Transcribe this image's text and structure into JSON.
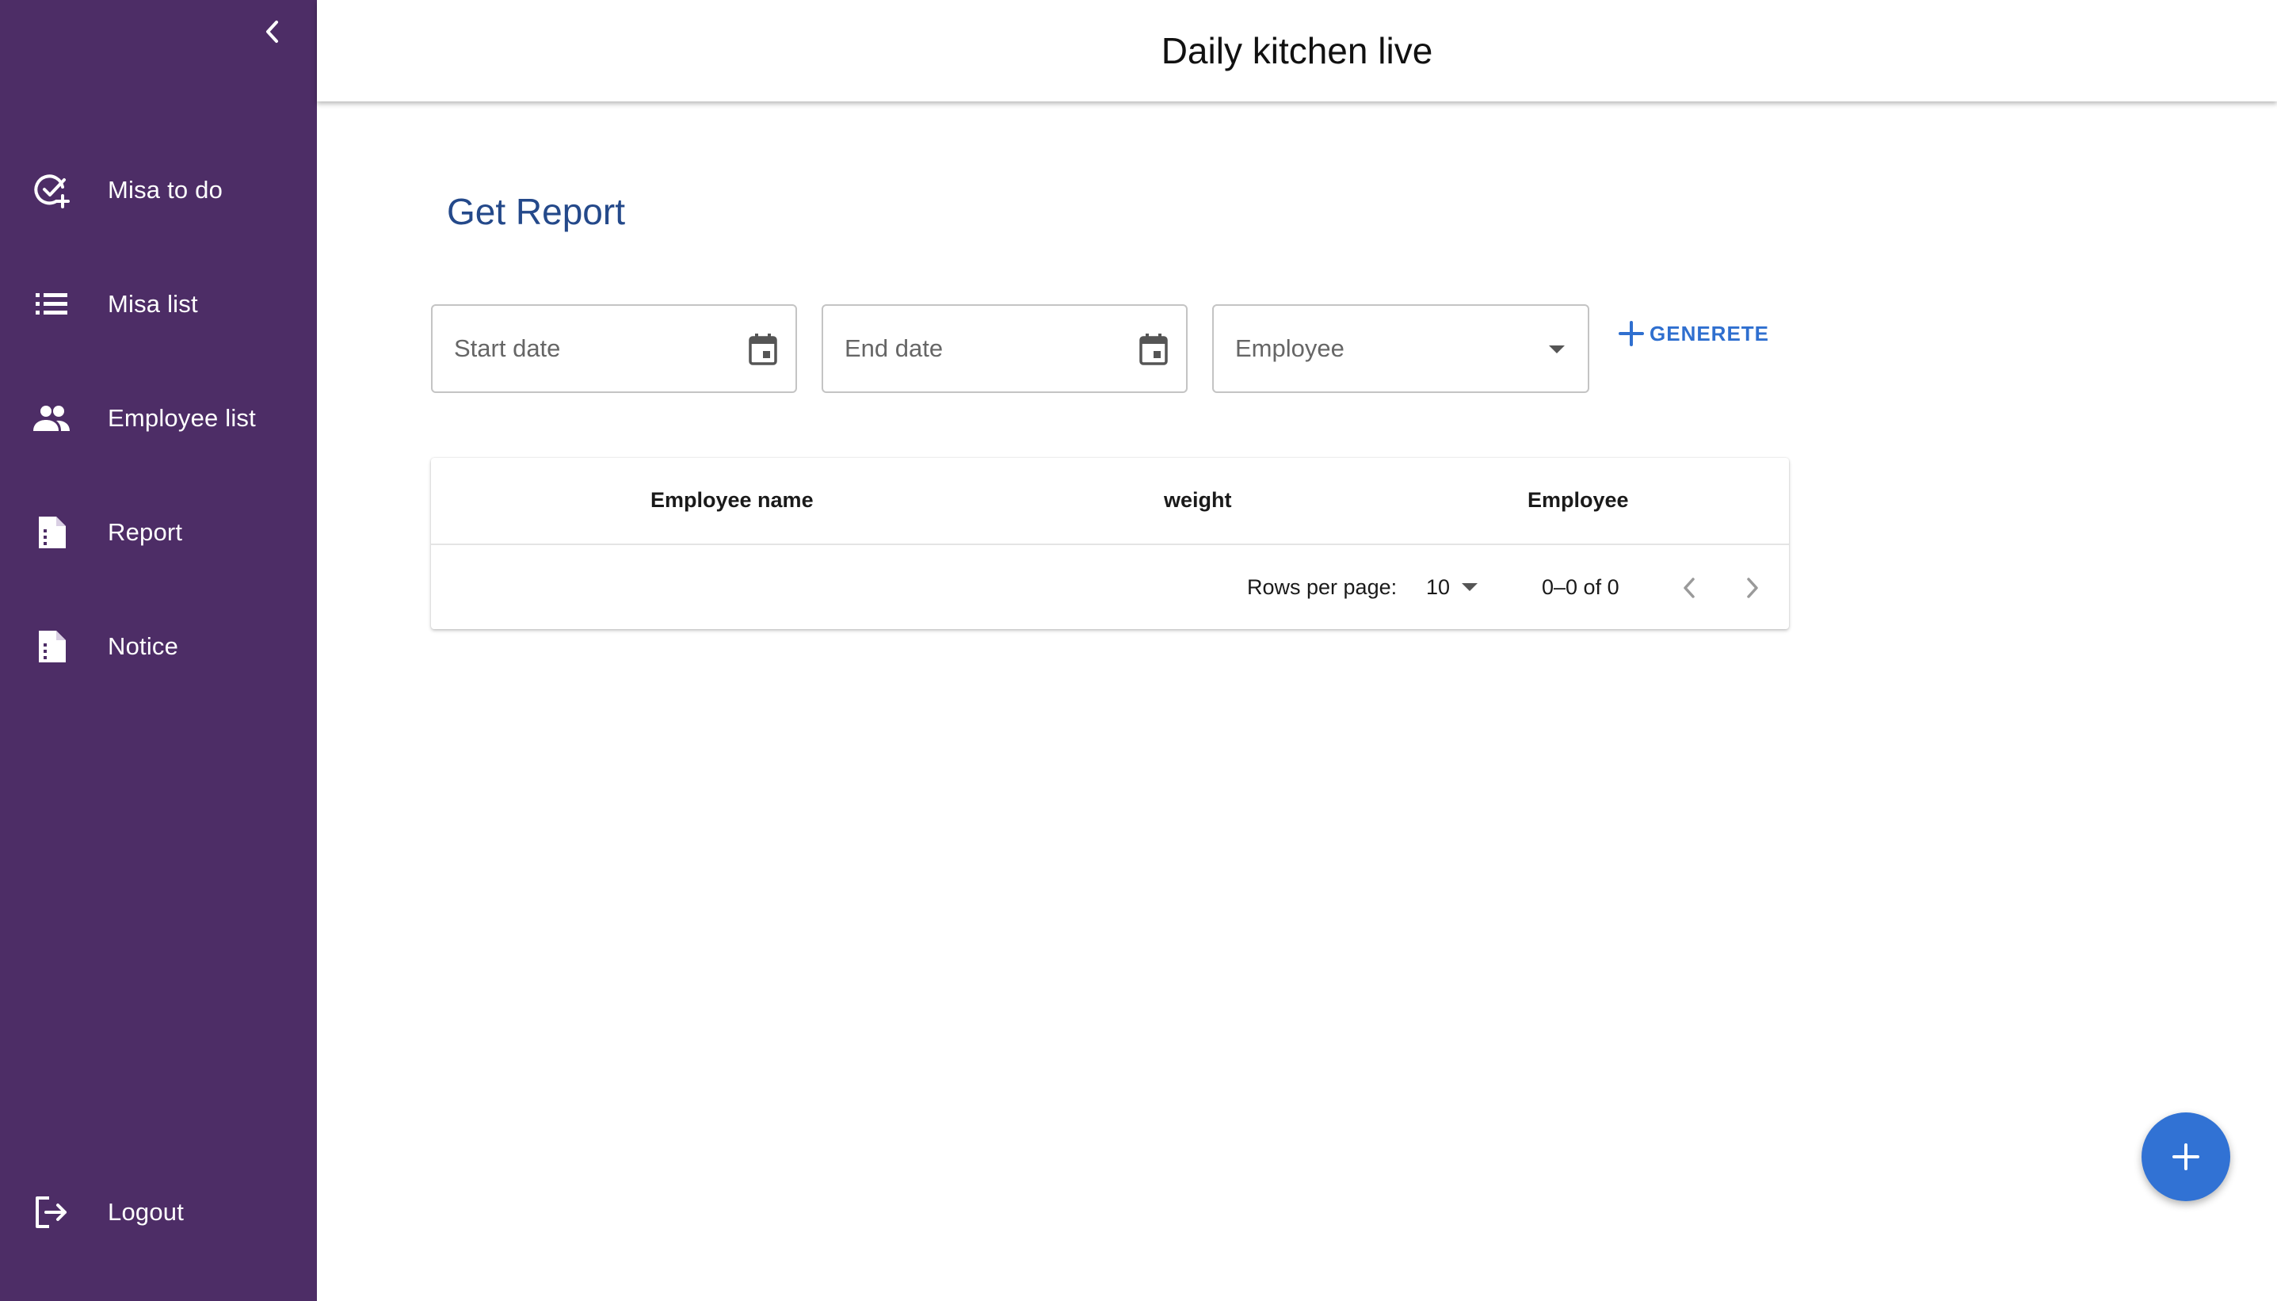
{
  "app": {
    "title": "Daily kitchen live"
  },
  "sidebar": {
    "background_color": "#4d2d66",
    "collapse_icon": "chevron-left-icon",
    "items": [
      {
        "label": "Misa to do",
        "icon": "check-circle-add-icon"
      },
      {
        "label": "Misa list",
        "icon": "list-icon"
      },
      {
        "label": "Employee list",
        "icon": "people-icon"
      },
      {
        "label": "Report",
        "icon": "document-icon"
      },
      {
        "label": "Notice",
        "icon": "document-icon"
      }
    ],
    "logout": {
      "label": "Logout",
      "icon": "logout-icon"
    }
  },
  "report": {
    "title": "Get Report",
    "start_date": {
      "placeholder": "Start date",
      "icon": "calendar-icon"
    },
    "end_date": {
      "placeholder": "End date",
      "icon": "calendar-icon"
    },
    "employee": {
      "placeholder": "Employee",
      "icon": "dropdown-arrow-icon"
    },
    "generate_label": "GENERETE",
    "accent_color": "#2f6fcf"
  },
  "table": {
    "columns": [
      "Employee name",
      "weight",
      "Employee"
    ],
    "rows": [],
    "pagination": {
      "rows_per_page_label": "Rows per page:",
      "rows_per_page": "10",
      "range": "0–0 of 0"
    }
  },
  "fab": {
    "icon": "plus-icon",
    "color": "#3172d4"
  }
}
